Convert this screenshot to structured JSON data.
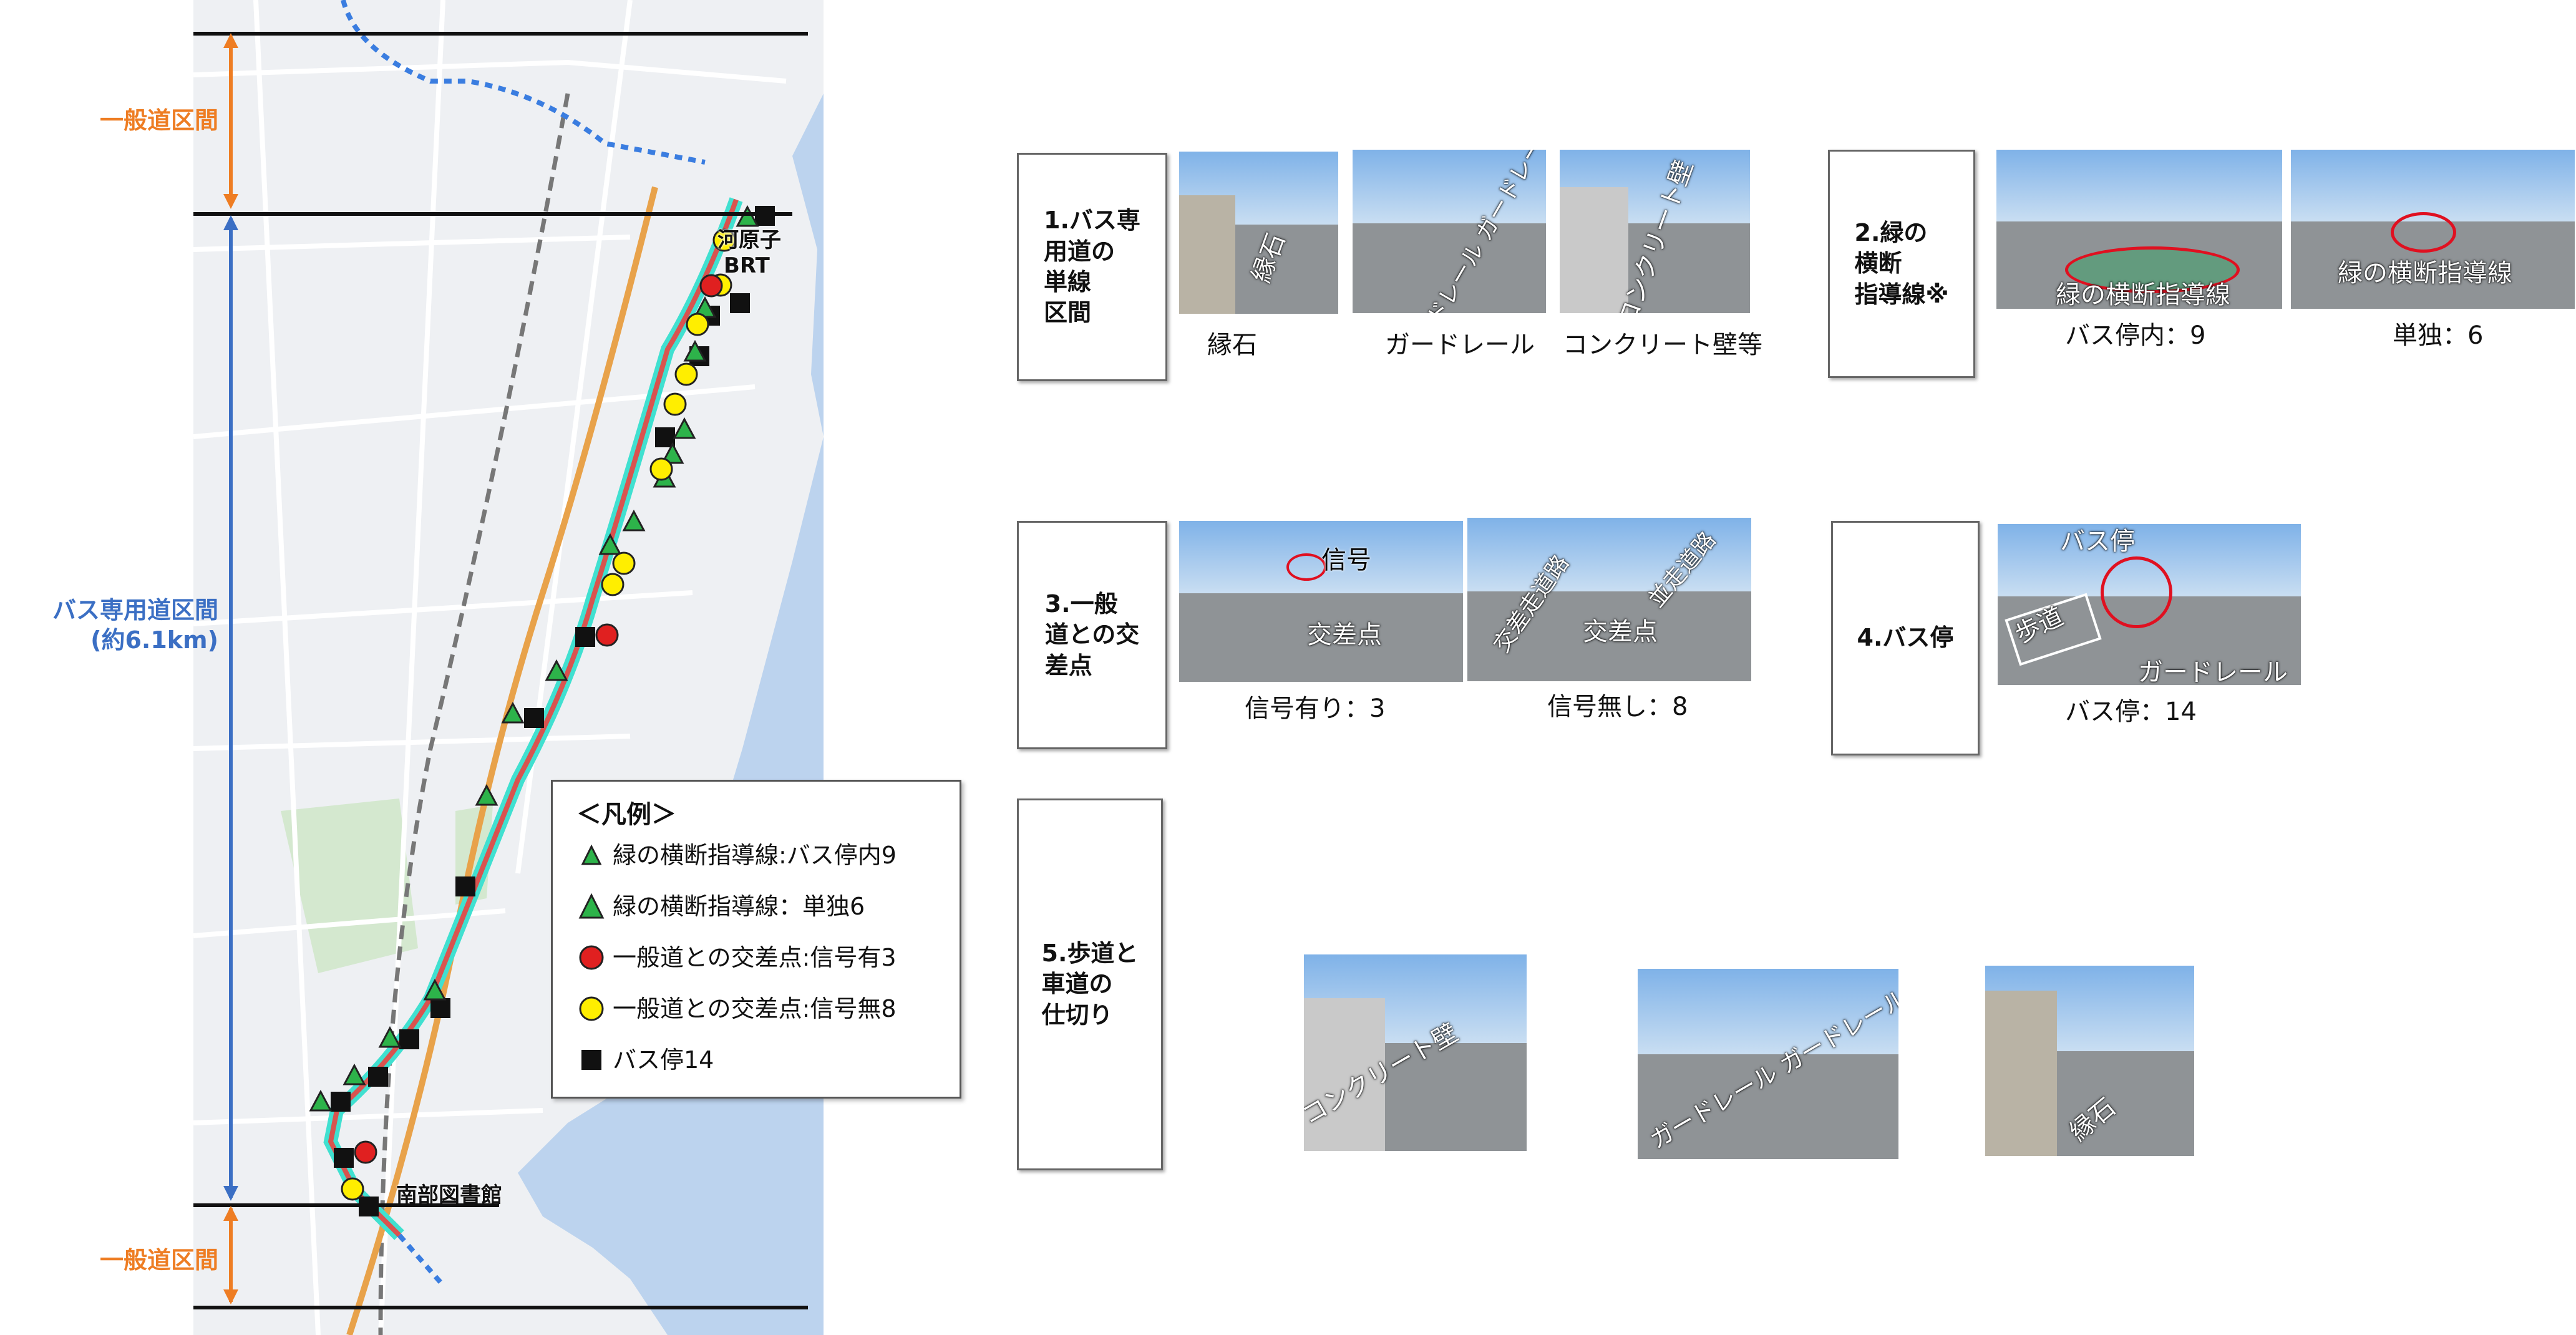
{
  "map": {
    "section_top": "一般道区間",
    "section_mid_line1": "バス専用道区間",
    "section_mid_line2": "(約6.1km)",
    "section_bottom": "一般道区間",
    "label_north_1": "河原子",
    "label_north_2": "BRT",
    "label_south": "南部図書館"
  },
  "legend": {
    "title": "＜凡例＞",
    "items": [
      {
        "symbol": "triangle-green-small",
        "label": "緑の横断指導線:バス停内9"
      },
      {
        "symbol": "triangle-green",
        "label": "緑の横断指導線：単独6"
      },
      {
        "symbol": "circle-red",
        "label": "一般道との交差点:信号有3"
      },
      {
        "symbol": "circle-yellow",
        "label": "一般道との交差点:信号無8"
      },
      {
        "symbol": "square-black",
        "label": "バス停14"
      }
    ]
  },
  "sections": [
    {
      "title": "1.バス専用道の単線区間",
      "title_lines": [
        "1.バス専",
        "用道の",
        "単線",
        "区間"
      ],
      "photos": [
        {
          "overlay": "縁石",
          "caption": "縁石"
        },
        {
          "overlay": "ガードレール ガードレール",
          "caption": "ガードレール"
        },
        {
          "overlay": "コンクリート壁",
          "caption": "コンクリート壁等"
        }
      ]
    },
    {
      "title": "2.緑の横断指導線※",
      "title_lines": [
        "2.緑の",
        "横断",
        "指導線※"
      ],
      "photos": [
        {
          "overlay": "緑の横断指導線",
          "caption": "バス停内：9"
        },
        {
          "overlay": "緑の横断指導線",
          "caption": "単独：6"
        }
      ]
    },
    {
      "title": "3.一般道との交差点",
      "title_lines": [
        "3.一般",
        "道との交",
        "差点"
      ],
      "photos": [
        {
          "overlay": "信号",
          "overlay2": "交差点",
          "caption": "信号有り：3"
        },
        {
          "overlay": "交差走道路",
          "overlay2": "並走道路",
          "overlay3": "交差点",
          "caption": "信号無し：8"
        }
      ]
    },
    {
      "title": "4.バス停",
      "title_lines": [
        "4.バス停"
      ],
      "photos": [
        {
          "overlay": "バス停",
          "overlay2": "歩道",
          "overlay3": "ガードレール",
          "caption": "バス停：14"
        }
      ]
    },
    {
      "title": "5.歩道と車道の仕切り",
      "title_lines": [
        "5.歩道と",
        "車道の",
        "仕切り"
      ],
      "photos": [
        {
          "overlay": "コンクリート壁"
        },
        {
          "overlay": "ガードレール ガードレール"
        },
        {
          "overlay": "縁石"
        }
      ]
    }
  ],
  "colors": {
    "route": "#d9534f",
    "busway": "#40e0d0",
    "triangle": "#2db34a",
    "red": "#e02020",
    "yellow": "#ffee00",
    "orange": "#ee7d23",
    "blue": "#3b6fc4"
  }
}
